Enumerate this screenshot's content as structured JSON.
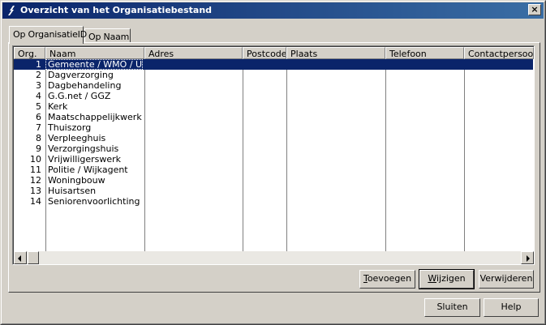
{
  "window": {
    "title": "Overzicht van het Organisatiebestand",
    "close_glyph": "×"
  },
  "tabs": [
    {
      "label": "Op OrganisatieID",
      "active": true
    },
    {
      "label": "Op Naam",
      "active": false
    }
  ],
  "grid": {
    "columns": [
      "Org.",
      "Naam",
      "Adres",
      "Postcode",
      "Plaats",
      "Telefoon",
      "Contactpersoon"
    ],
    "rows": [
      {
        "id": "1",
        "naam": "Gemeente / WMO / Uitk",
        "selected": true
      },
      {
        "id": "2",
        "naam": "Dagverzorging"
      },
      {
        "id": "3",
        "naam": "Dagbehandeling"
      },
      {
        "id": "4",
        "naam": "G.G.net / GGZ"
      },
      {
        "id": "5",
        "naam": "Kerk"
      },
      {
        "id": "6",
        "naam": "Maatschappelijkwerk /Sc"
      },
      {
        "id": "7",
        "naam": "Thuiszorg"
      },
      {
        "id": "8",
        "naam": "Verpleeghuis"
      },
      {
        "id": "9",
        "naam": "Verzorgingshuis"
      },
      {
        "id": "10",
        "naam": "Vrijwilligerswerk"
      },
      {
        "id": "11",
        "naam": "Politie / Wijkagent"
      },
      {
        "id": "12",
        "naam": "Woningbouw"
      },
      {
        "id": "13",
        "naam": "Huisartsen"
      },
      {
        "id": "14",
        "naam": "Seniorenvoorlichting"
      }
    ]
  },
  "buttons": {
    "toevoegen": {
      "mnemonic": "T",
      "rest": "oevoegen"
    },
    "wijzigen": {
      "mnemonic": "W",
      "rest": "ijzigen"
    },
    "verwijderen": {
      "label": "Verwijderen"
    },
    "sluiten": {
      "label": "Sluiten"
    },
    "help": {
      "label": "Help"
    }
  },
  "icons": {
    "app": "app-icon",
    "close": "close-icon",
    "scroll_left": "arrow-left-icon",
    "scroll_right": "arrow-right-icon"
  }
}
